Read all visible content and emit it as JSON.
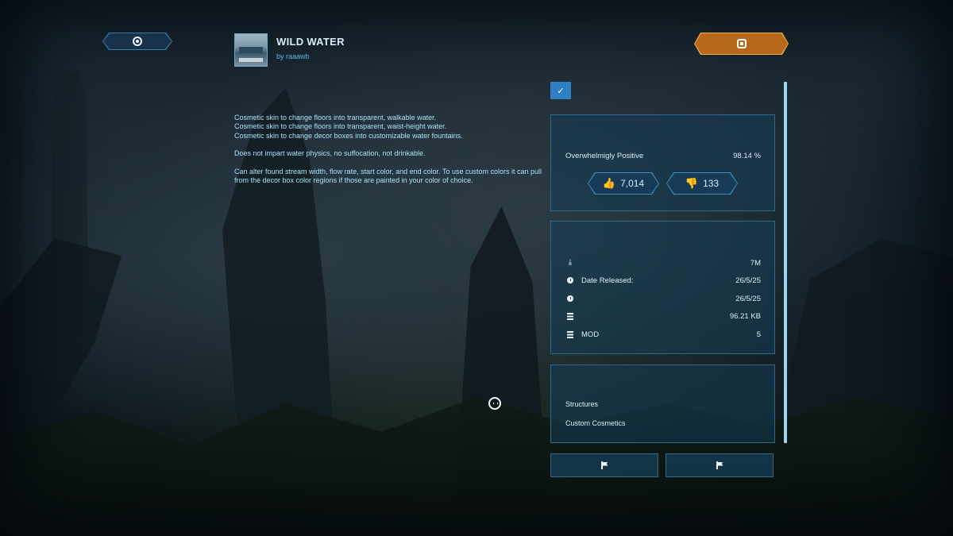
{
  "mod": {
    "title": "WILD WATER",
    "author": "by raaawb",
    "description": [
      "Cosmetic skin to change floors into transparent, walkable water.",
      "Cosmetic skin to change floors into transparent, waist-height water.",
      "Cosmetic skin to change decor boxes into customizable water fountains.",
      "Does not impart water physics, no suffocation, not drinkable.",
      "Can alter found stream width, flow rate, start color, and end color. To use custom colors it can pull from the decor box color regions if those are painted in your color of choice."
    ]
  },
  "header": {
    "left_button_icon": "target-icon",
    "right_button_icon": "stop-square-icon"
  },
  "checkbox": {
    "checked": true,
    "glyph": "✓"
  },
  "rating": {
    "label": "Overwhelmigly Positive",
    "percent": "98.14 %",
    "upvotes": "7,014",
    "downvotes": "133",
    "up_icon": "👍",
    "down_icon": "👎"
  },
  "details": [
    {
      "icon": "download-icon",
      "label": "",
      "value": "7M"
    },
    {
      "icon": "clock-icon",
      "label": "Date Released:",
      "value": "26/5/25"
    },
    {
      "icon": "clock-icon",
      "label": "",
      "value": "26/5/25"
    },
    {
      "icon": "storage-icon",
      "label": "",
      "value": "96.21 KB"
    },
    {
      "icon": "storage-icon",
      "label": "MOD",
      "value": "5"
    }
  ],
  "tags": [
    "Structures",
    "Custom Cosmetics"
  ],
  "colors": {
    "accent_blue": "#2e7fc3",
    "accent_orange": "#b8681b",
    "panel_border": "#2f6a8b",
    "text_light": "#a8e1fb"
  }
}
